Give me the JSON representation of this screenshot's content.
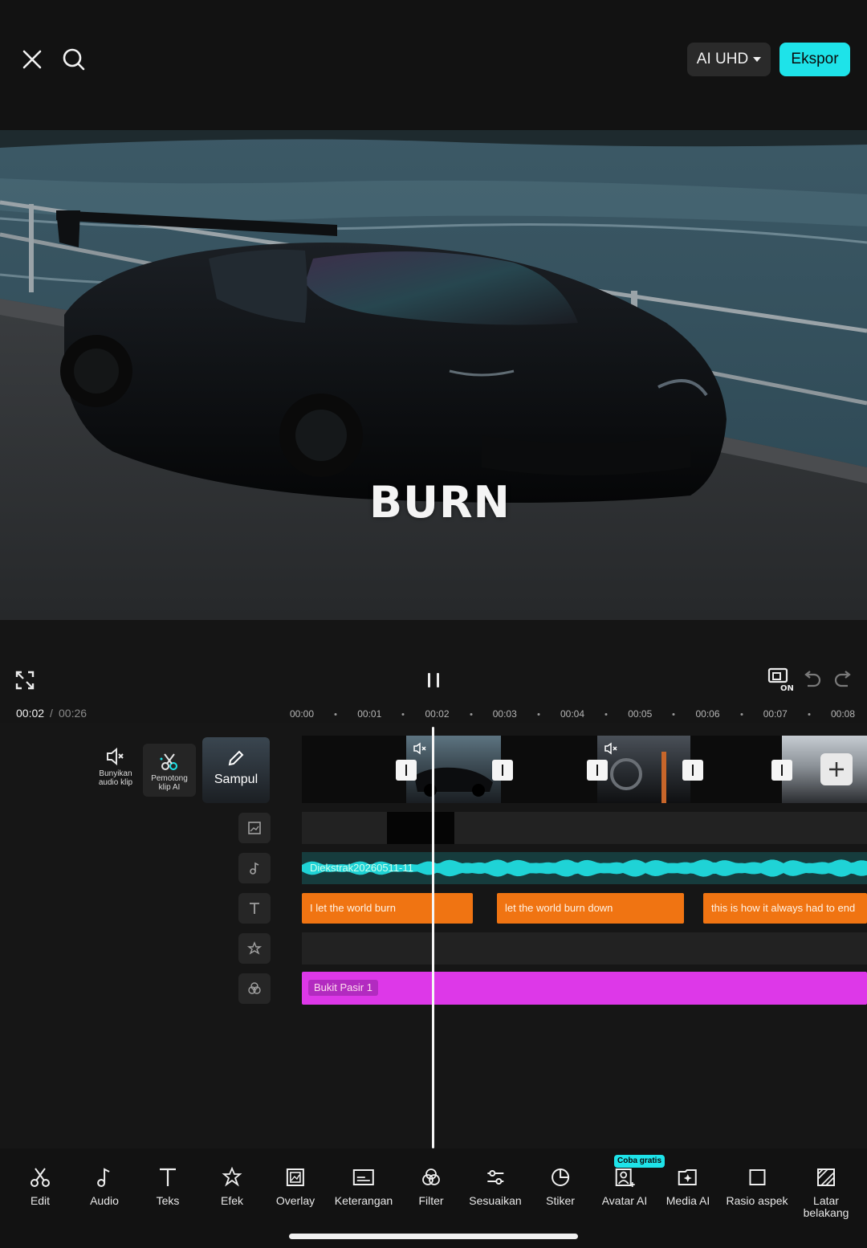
{
  "header": {
    "quality_label": "AI UHD",
    "export_label": "Ekspor"
  },
  "preview": {
    "caption": "BURN"
  },
  "playback": {
    "current_time": "00:02",
    "separator": "/",
    "total_time": "00:26"
  },
  "ruler": {
    "ticks": [
      "00:00",
      "00:01",
      "00:02",
      "00:03",
      "00:04",
      "00:05",
      "00:06",
      "00:07",
      "00:08"
    ]
  },
  "timeline": {
    "mute_label": "Bunyikan audio klip",
    "cutter_label": "Pemotong klip AI",
    "cover_label": "Sampul",
    "audio_clip_label": "Diekstrak20260511-11",
    "text_clips": [
      "I let the world burn",
      "let the world burn down",
      "this is how it always had to end"
    ],
    "effect_label": "Bukit Pasir 1"
  },
  "toolbar": {
    "items": [
      {
        "label": "Edit",
        "icon": "scissors-icon"
      },
      {
        "label": "Audio",
        "icon": "music-note-icon"
      },
      {
        "label": "Teks",
        "icon": "text-icon"
      },
      {
        "label": "Efek",
        "icon": "sparkle-icon"
      },
      {
        "label": "Overlay",
        "icon": "overlay-icon"
      },
      {
        "label": "Keterangan",
        "icon": "captions-icon"
      },
      {
        "label": "Filter",
        "icon": "filter-icon"
      },
      {
        "label": "Sesuaikan",
        "icon": "sliders-icon"
      },
      {
        "label": "Stiker",
        "icon": "sticker-icon"
      },
      {
        "label": "Avatar AI",
        "icon": "avatar-icon"
      },
      {
        "label": "Media AI",
        "icon": "media-ai-icon"
      },
      {
        "label": "Rasio aspek",
        "icon": "aspect-ratio-icon"
      },
      {
        "label": "Latar belakang",
        "icon": "background-icon"
      }
    ],
    "trial_badge": "Coba gratis"
  },
  "colors": {
    "accent": "#1ee3e9",
    "text_clip": "#f07412",
    "effect_clip": "#dd38e8",
    "audio_wave": "#1fd3d6"
  }
}
